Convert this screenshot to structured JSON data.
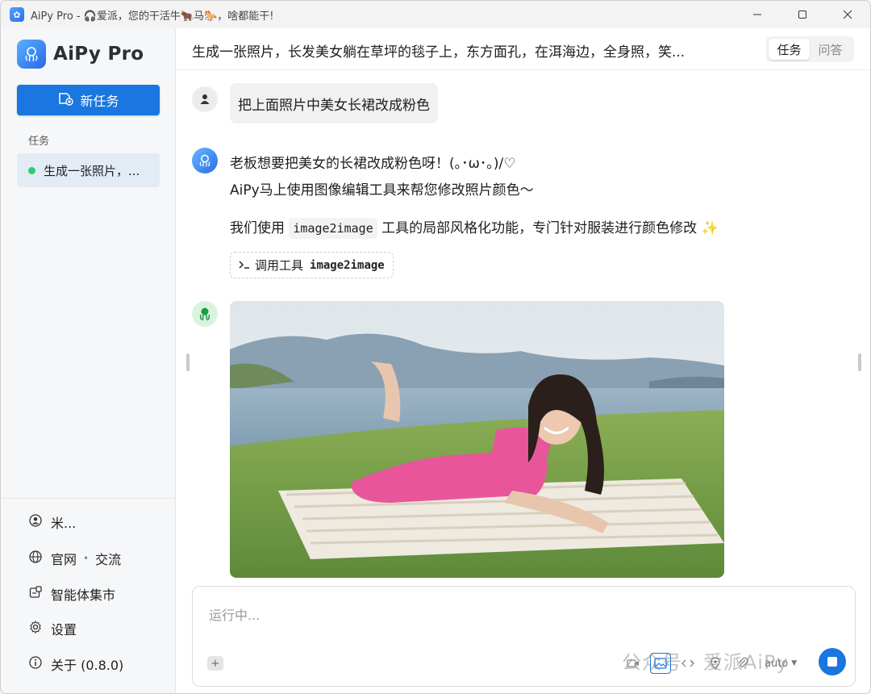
{
  "window": {
    "title": "AiPy Pro - 🎧爱派，您的干活牛🐂马🐎，啥都能干!",
    "minimize_icon": "minimize-icon",
    "maximize_icon": "maximize-icon",
    "close_icon": "close-icon"
  },
  "sidebar": {
    "brand": "AiPy Pro",
    "new_task_label": "新任务",
    "section_label": "任务",
    "tasks": [
      {
        "label": "生成一张照片，...",
        "status_color": "#2ecc71"
      }
    ],
    "links": [
      {
        "icon": "user-icon",
        "label": "米..."
      },
      {
        "icon": "globe-icon",
        "label": "官网",
        "extra": "交流"
      },
      {
        "icon": "agent-market-icon",
        "label": "智能体集市"
      },
      {
        "icon": "gear-icon",
        "label": "设置"
      },
      {
        "icon": "info-icon",
        "label": "关于 (0.8.0)"
      }
    ]
  },
  "header": {
    "title": "生成一张照片，长发美女躺在草坪的毯子上，东方面孔，在洱海边，全身照，笑...",
    "modes": [
      "任务",
      "问答"
    ],
    "active_mode": "任务"
  },
  "messages": {
    "user": "把上面照片中美女长裙改成粉色",
    "ai_line1": "老板想要把美女的长裙改成粉色呀！(｡･ω･｡)/♡",
    "ai_line2": "AiPy马上使用图像编辑工具来帮您修改照片颜色～",
    "ai_line3_pre": "我们使用",
    "ai_line3_code": "image2image",
    "ai_line3_post": "工具的局部风格化功能，专门针对服装进行颜色修改 ✨",
    "tool_call_label": "调用工具",
    "tool_call_name": "image2image",
    "image_description_icon": "generated-photo"
  },
  "composer": {
    "placeholder": "运行中...",
    "model": "auto"
  },
  "watermark": "公众号 · 爱派AiPy",
  "colors": {
    "accent": "#1a76e0",
    "sidebar_bg": "#f6f7f9",
    "active_task_bg": "#e3ebf5",
    "status_green": "#2ecc71",
    "dress_pink": "#e8559a"
  }
}
